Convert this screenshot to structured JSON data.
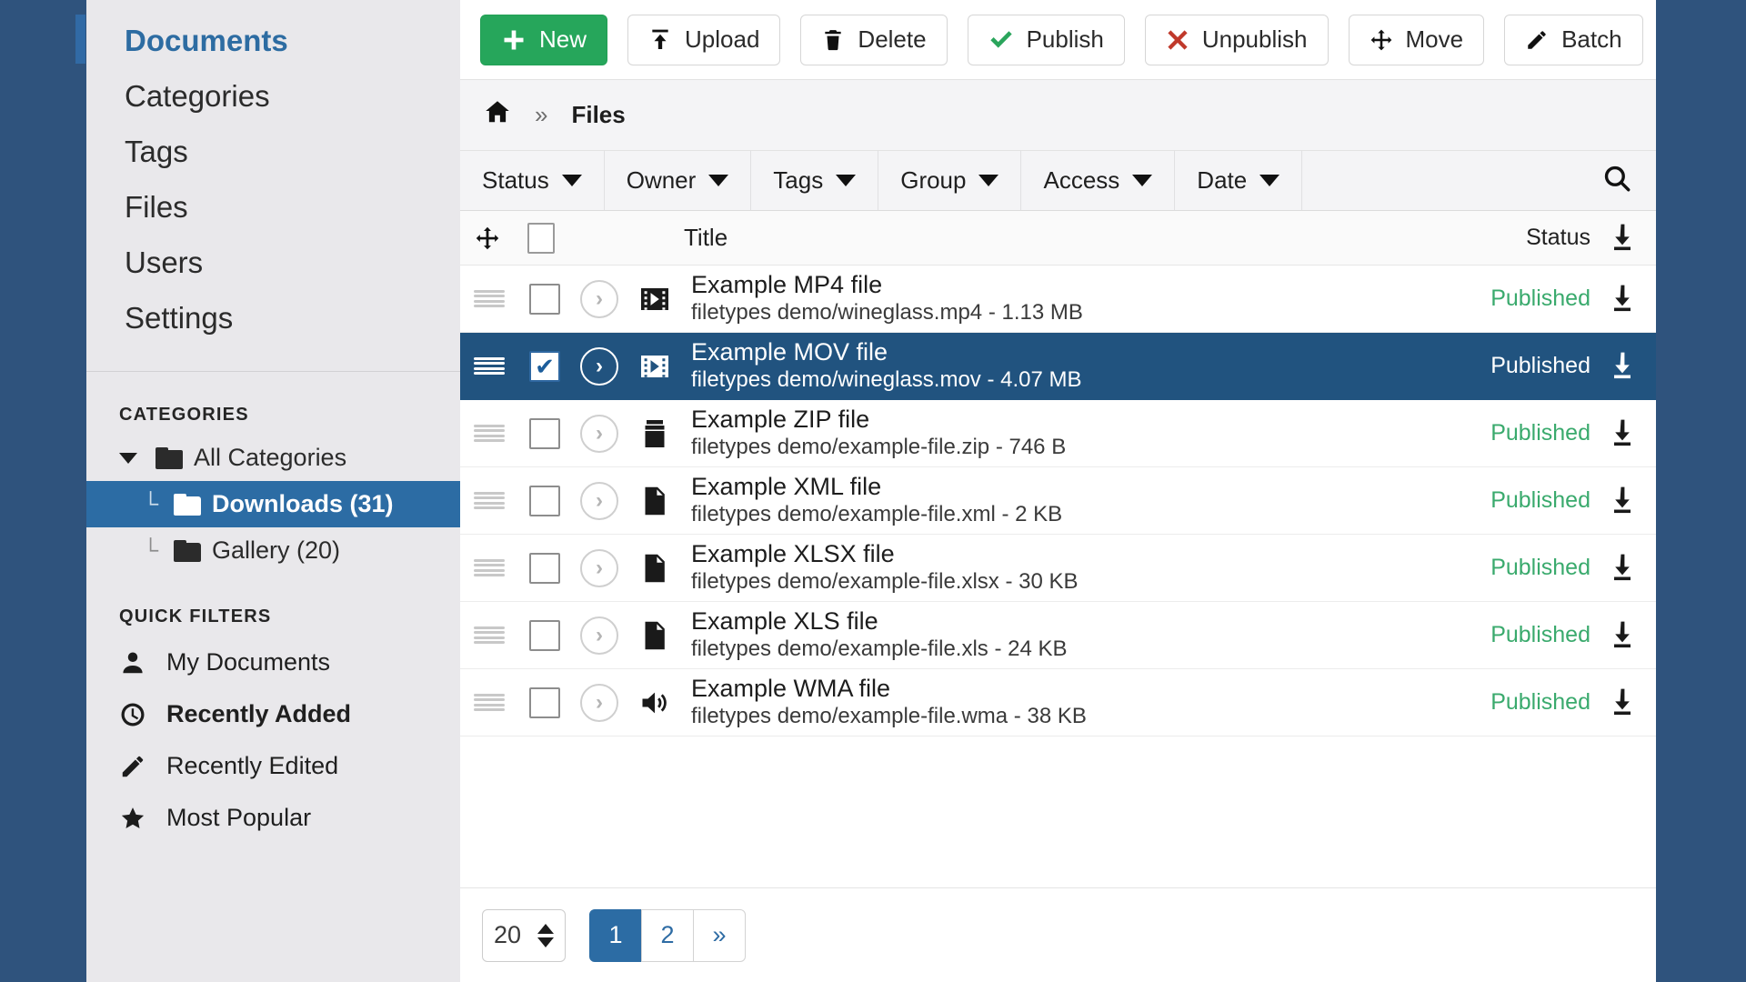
{
  "sidebar": {
    "nav": [
      {
        "label": "Documents",
        "active": true
      },
      {
        "label": "Categories",
        "active": false
      },
      {
        "label": "Tags",
        "active": false
      },
      {
        "label": "Files",
        "active": false
      },
      {
        "label": "Users",
        "active": false
      },
      {
        "label": "Settings",
        "active": false
      }
    ],
    "categories": {
      "heading": "CATEGORIES",
      "root": {
        "label": "All Categories",
        "icon": "folder-open-icon"
      },
      "items": [
        {
          "label": "Downloads (31)",
          "icon": "folder-icon",
          "selected": true
        },
        {
          "label": "Gallery (20)",
          "icon": "folder-icon",
          "selected": false
        }
      ]
    },
    "quick_filters": {
      "heading": "QUICK FILTERS",
      "items": [
        {
          "label": "My Documents",
          "icon": "user-icon",
          "active": false
        },
        {
          "label": "Recently Added",
          "icon": "clock-icon",
          "active": true
        },
        {
          "label": "Recently Edited",
          "icon": "pencil-icon",
          "active": false
        },
        {
          "label": "Most Popular",
          "icon": "star-icon",
          "active": false
        }
      ]
    }
  },
  "toolbar": {
    "buttons": [
      {
        "label": "New",
        "icon": "plus-icon",
        "style": "primary"
      },
      {
        "label": "Upload",
        "icon": "upload-icon",
        "style": "default"
      },
      {
        "label": "Delete",
        "icon": "trash-icon",
        "style": "default"
      },
      {
        "label": "Publish",
        "icon": "check-icon",
        "style": "default"
      },
      {
        "label": "Unpublish",
        "icon": "x-icon",
        "style": "default"
      },
      {
        "label": "Move",
        "icon": "move-icon",
        "style": "default"
      },
      {
        "label": "Batch",
        "icon": "pencil-icon",
        "style": "default"
      }
    ]
  },
  "breadcrumb": {
    "home_icon": "home-icon",
    "separator": "»",
    "current": "Files"
  },
  "filters": {
    "tabs": [
      "Status",
      "Owner",
      "Tags",
      "Group",
      "Access",
      "Date"
    ],
    "search_icon": "search-icon"
  },
  "table": {
    "headers": {
      "move": "move-icon",
      "title": "Title",
      "status": "Status",
      "download": "download-icon"
    },
    "rows": [
      {
        "title": "Example MP4 file",
        "path": "filetypes demo/wineglass.mp4 - 1.13 MB",
        "status": "Published",
        "icon": "video-icon",
        "selected": false
      },
      {
        "title": "Example MOV file",
        "path": "filetypes demo/wineglass.mov - 4.07 MB",
        "status": "Published",
        "icon": "video-icon",
        "selected": true
      },
      {
        "title": "Example ZIP file",
        "path": "filetypes demo/example-file.zip - 746 B",
        "status": "Published",
        "icon": "archive-icon",
        "selected": false
      },
      {
        "title": "Example XML file",
        "path": "filetypes demo/example-file.xml - 2 KB",
        "status": "Published",
        "icon": "document-icon",
        "selected": false
      },
      {
        "title": "Example XLSX file",
        "path": "filetypes demo/example-file.xlsx - 30 KB",
        "status": "Published",
        "icon": "spreadsheet-icon",
        "selected": false
      },
      {
        "title": "Example XLS file",
        "path": "filetypes demo/example-file.xls - 24 KB",
        "status": "Published",
        "icon": "spreadsheet-icon",
        "selected": false
      },
      {
        "title": "Example WMA file",
        "path": "filetypes demo/example-file.wma - 38 KB",
        "status": "Published",
        "icon": "audio-icon",
        "selected": false
      }
    ]
  },
  "pagination": {
    "limit": "20",
    "pages": [
      {
        "label": "1",
        "active": true
      },
      {
        "label": "2",
        "active": false
      },
      {
        "label": "»",
        "active": false
      }
    ]
  },
  "colors": {
    "page_background": "#2f537d",
    "sidebar_background": "#e9e8eb",
    "accent_blue": "#2c6ca4",
    "selected_row": "#21537f",
    "published_green": "#3aaa6d",
    "new_button_green": "#26a65b",
    "unpublish_red": "#c0392b"
  }
}
